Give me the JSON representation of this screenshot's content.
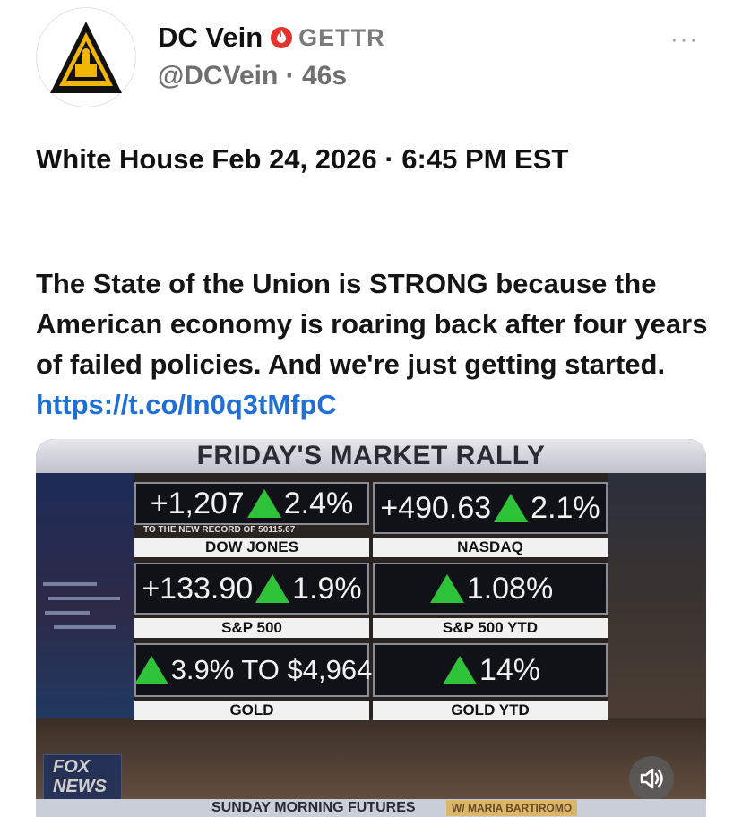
{
  "post": {
    "display_name": "DC Vein",
    "platform": "GETTR",
    "handle": "@DCVein",
    "separator": "·",
    "time": "46s",
    "more": "···",
    "subheading": "White House Feb 24, 2026 · 6:45 PM EST",
    "body_text": "The State of the Union is STRONG because the American economy is roaring back after four years of failed policies. And we're just getting started.",
    "link": "https://t.co/In0q3tMfpC"
  },
  "media": {
    "banner": "FRIDAY'S MARKET RALLY",
    "ticker": "SUNDAY MORNING FUTURES",
    "ticker_tag": "W/ MARIA BARTIROMO",
    "network_logo": "FOX NEWS",
    "panels": [
      {
        "pre": "+1,207",
        "value": "2.4%",
        "note": "TO THE NEW RECORD OF 50115.67",
        "label": "DOW JONES"
      },
      {
        "pre": "+490.63",
        "value": "2.1%",
        "label": "NASDAQ"
      },
      {
        "pre": "+133.90",
        "value": "1.9%",
        "label": "S&P 500"
      },
      {
        "pre": "",
        "value": "1.08%",
        "label": "S&P 500 YTD"
      },
      {
        "pre": "",
        "value": "3.9% TO $4,964",
        "label": "GOLD"
      },
      {
        "pre": "",
        "value": "14%",
        "label": "GOLD YTD"
      }
    ]
  },
  "icons": {
    "avatar": "capitol-pyramid-logo",
    "verified": "gettr-verified-badge",
    "up": "green-up-triangle",
    "mute": "speaker-icon"
  },
  "colors": {
    "link": "#1f6fd6",
    "verified": "#e4342d",
    "up_arrow": "#2fc33a",
    "avatar_gold": "#f2b705"
  }
}
